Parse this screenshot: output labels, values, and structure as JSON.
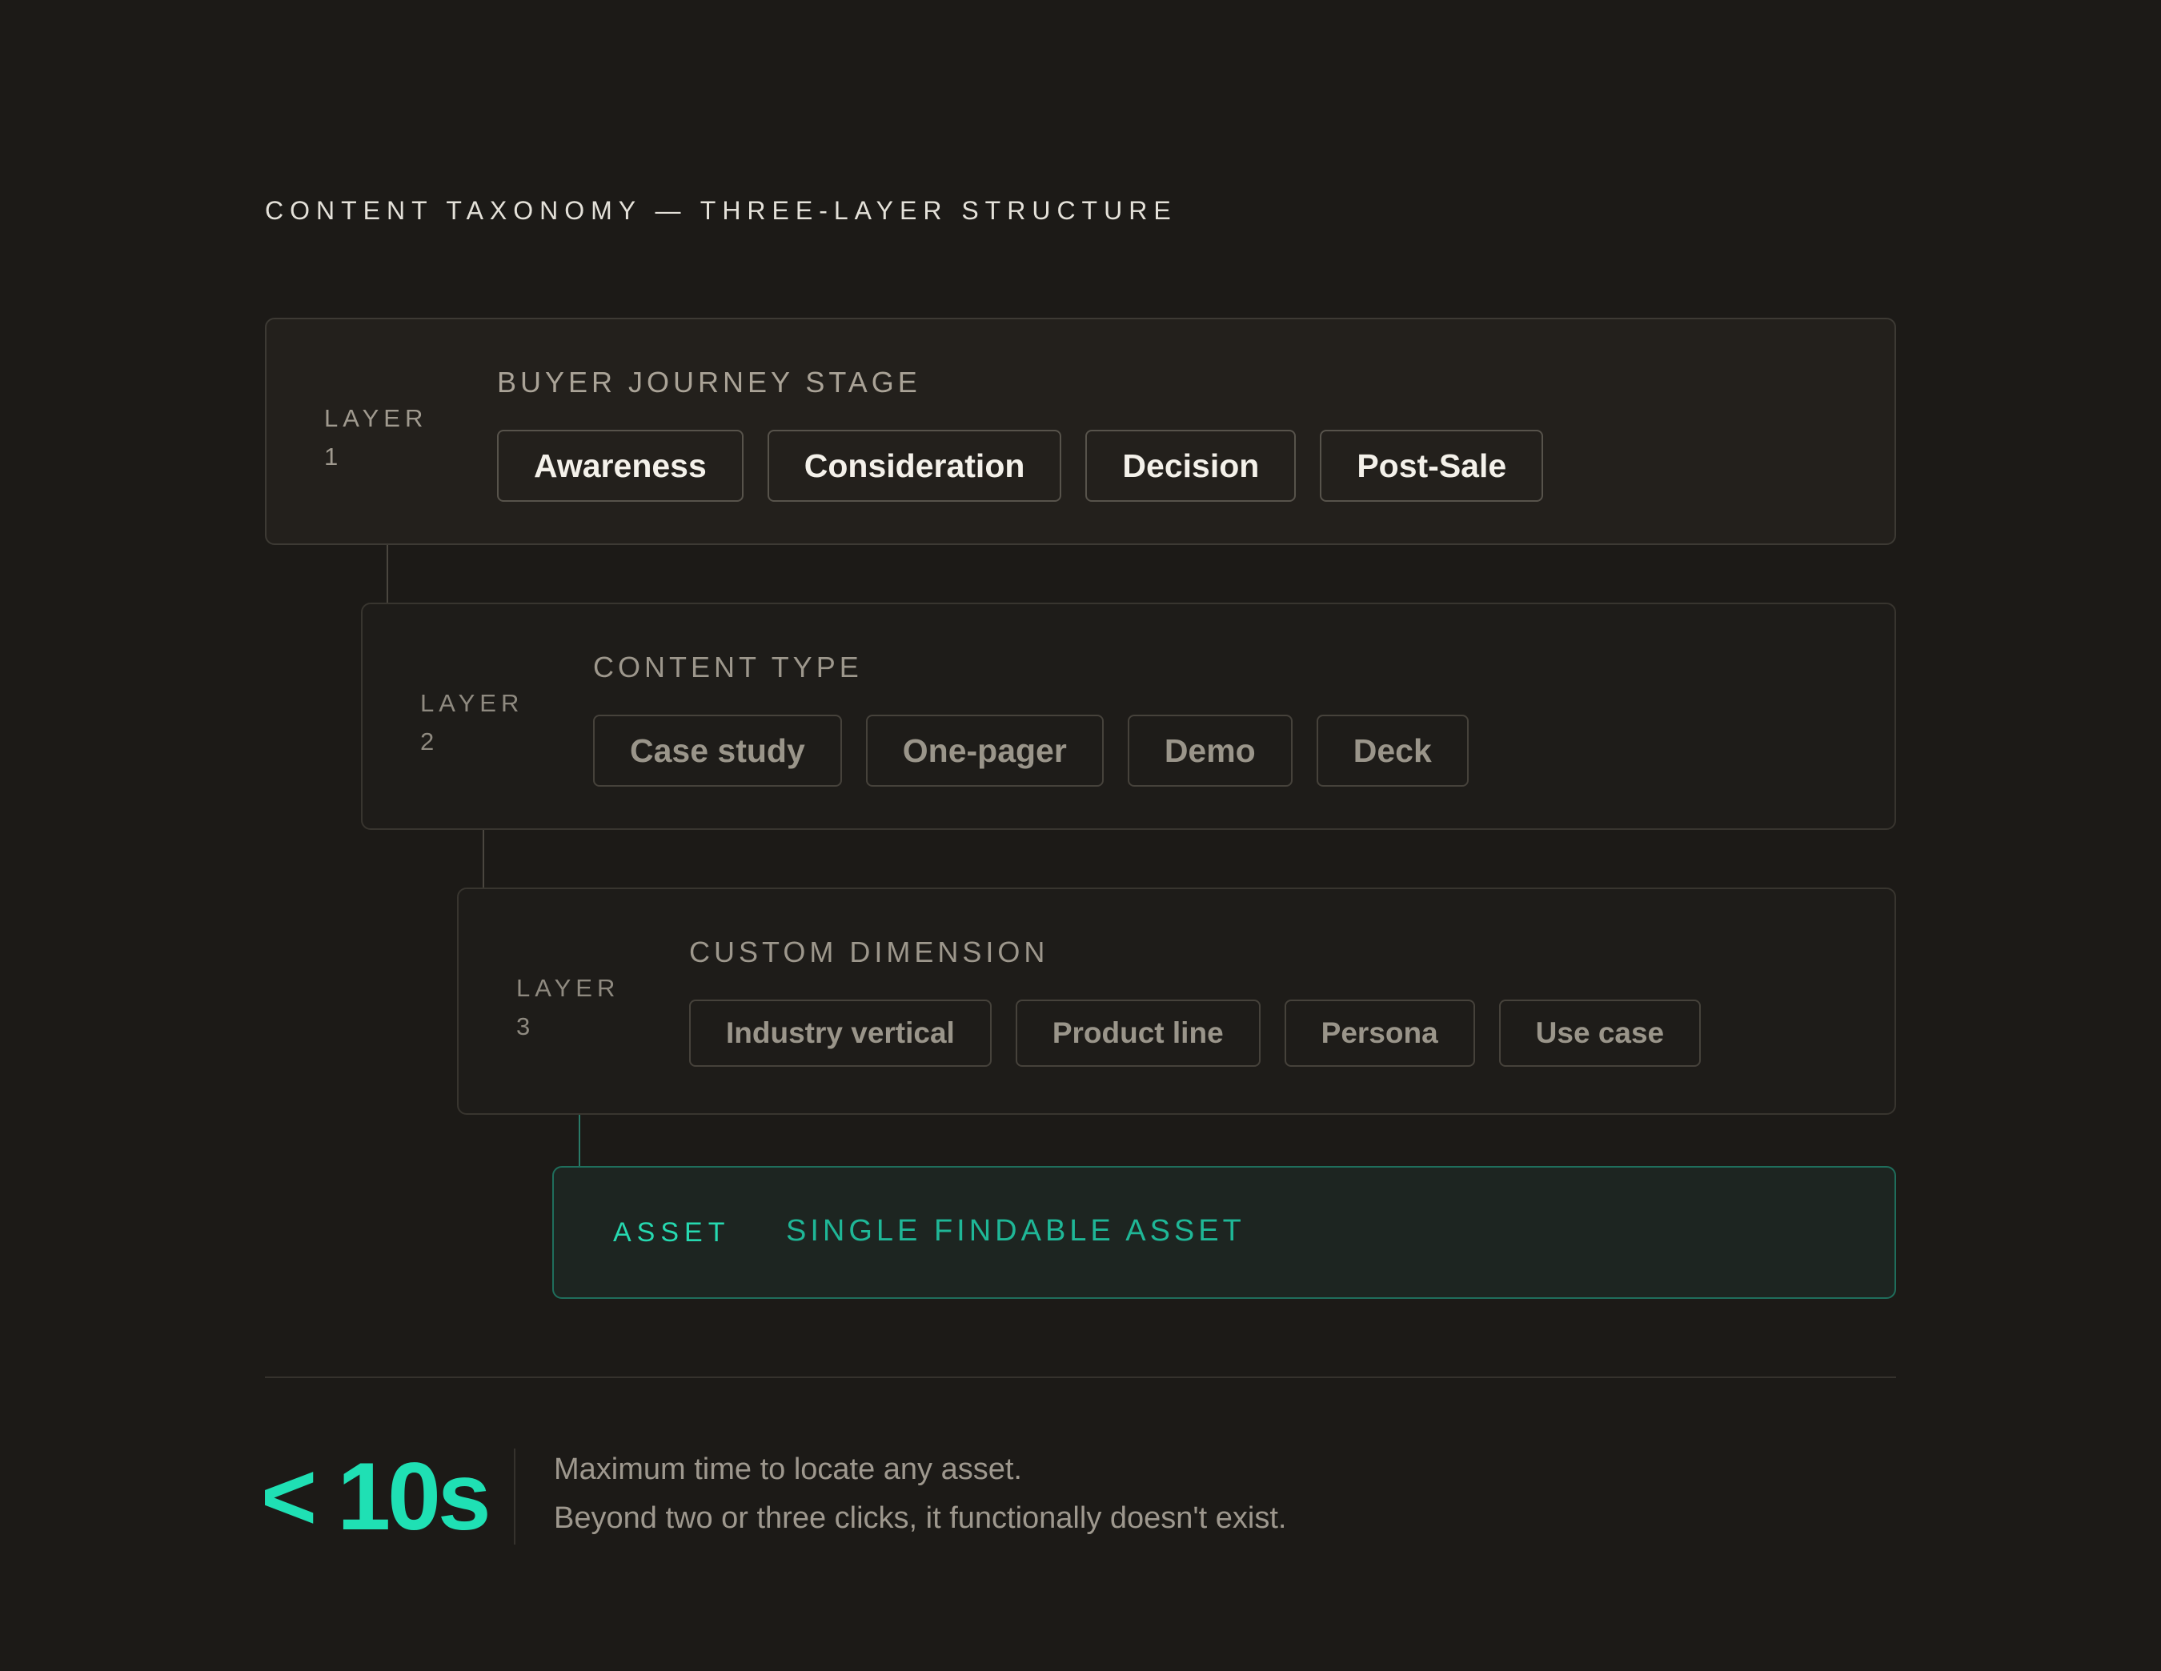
{
  "heading": "CONTENT TAXONOMY — THREE-LAYER STRUCTURE",
  "layers": [
    {
      "label": "LAYER 1",
      "title": "BUYER JOURNEY STAGE",
      "chips": [
        "Awareness",
        "Consideration",
        "Decision",
        "Post-Sale"
      ]
    },
    {
      "label": "LAYER 2",
      "title": "CONTENT TYPE",
      "chips": [
        "Case study",
        "One-pager",
        "Demo",
        "Deck"
      ]
    },
    {
      "label": "LAYER 3",
      "title": "CUSTOM DIMENSION",
      "chips": [
        "Industry vertical",
        "Product line",
        "Persona",
        "Use case"
      ]
    }
  ],
  "asset": {
    "label": "ASSET",
    "title": "SINGLE FINDABLE ASSET"
  },
  "stat": {
    "value": "< 10s",
    "line1": "Maximum time to locate any asset.",
    "line2": "Beyond two or three clicks, it functionally doesn't exist."
  },
  "colors": {
    "background": "#1c1a17",
    "accent": "#1fe0b4"
  }
}
